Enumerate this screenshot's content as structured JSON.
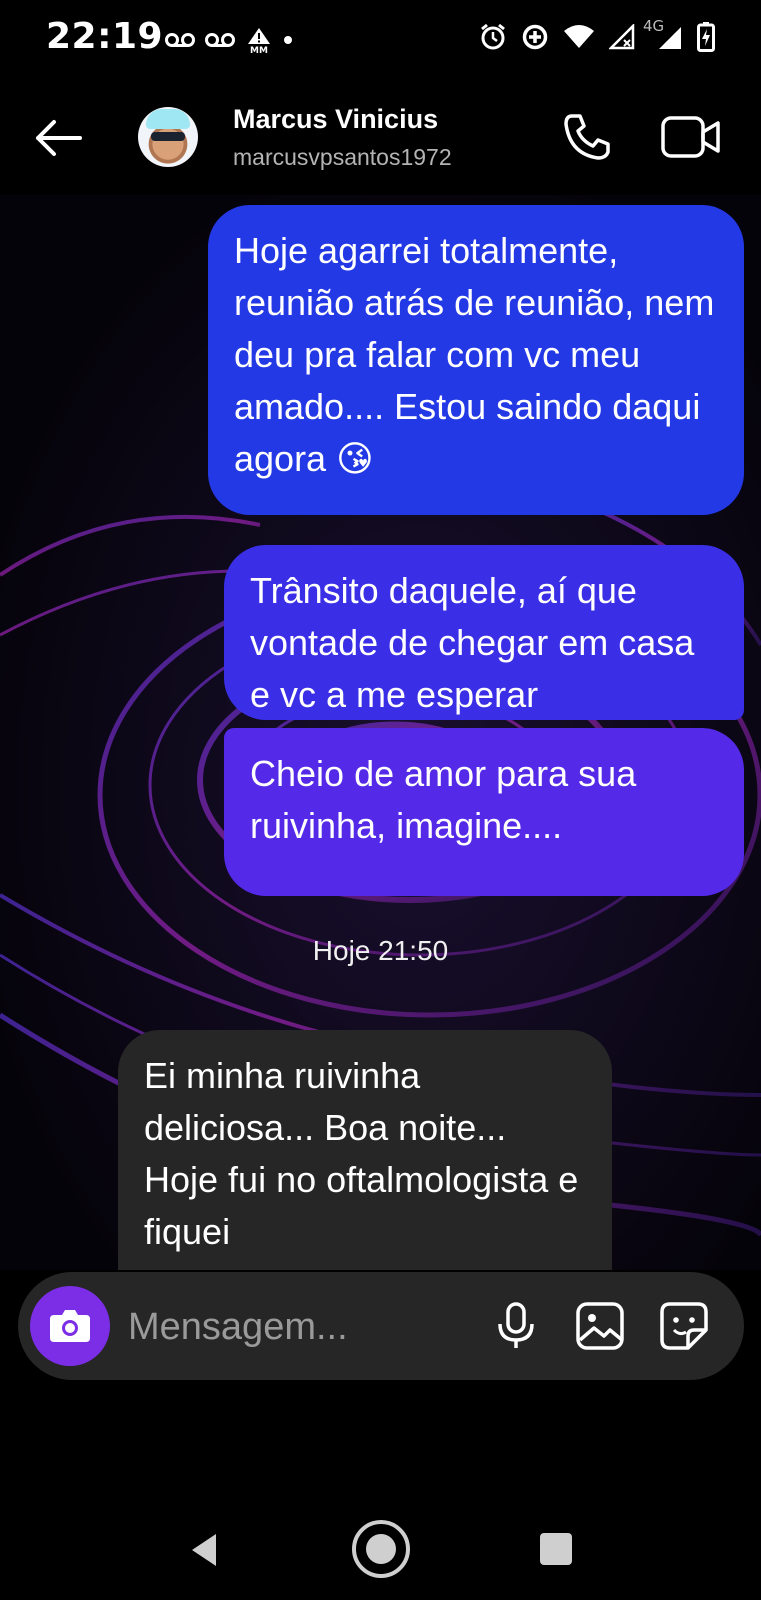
{
  "status_bar": {
    "time": "22:19",
    "icons_left": [
      "voicemail-icon",
      "voicemail-icon",
      "mm-alert-icon",
      "dot-icon"
    ],
    "icons_right": [
      "alarm-icon",
      "data-saver-icon",
      "wifi-icon",
      "signal-no-service-icon",
      "signal-4g-icon",
      "battery-charging-icon"
    ],
    "network_label": "4G"
  },
  "header": {
    "contact_name": "Marcus Vinicius",
    "username": "marcusvpsantos1972"
  },
  "messages": [
    {
      "direction": "outgoing",
      "text": "Hoje agarrei totalmente, reunião atrás de reunião, nem deu pra falar com vc meu amado.... Estou saindo daqui agora 😘"
    },
    {
      "direction": "outgoing",
      "text": "Trânsito daquele, aí que vontade de chegar em casa e vc a me esperar"
    },
    {
      "direction": "outgoing",
      "text": "Cheio de amor para sua ruivinha, imagine...."
    },
    {
      "direction": "incoming",
      "text": "Ei minha ruivinha deliciosa... Boa noite... Hoje fui no oftalmologista e fiquei"
    }
  ],
  "date_separator": "Hoje 21:50",
  "composer": {
    "placeholder": "Mensagem..."
  },
  "colors": {
    "bubble_out_1": "#2439e6",
    "bubble_out_2": "#3a2fe6",
    "bubble_out_3": "#5429e8",
    "bubble_in": "#262626",
    "camera_button": "#7c2ee6"
  }
}
